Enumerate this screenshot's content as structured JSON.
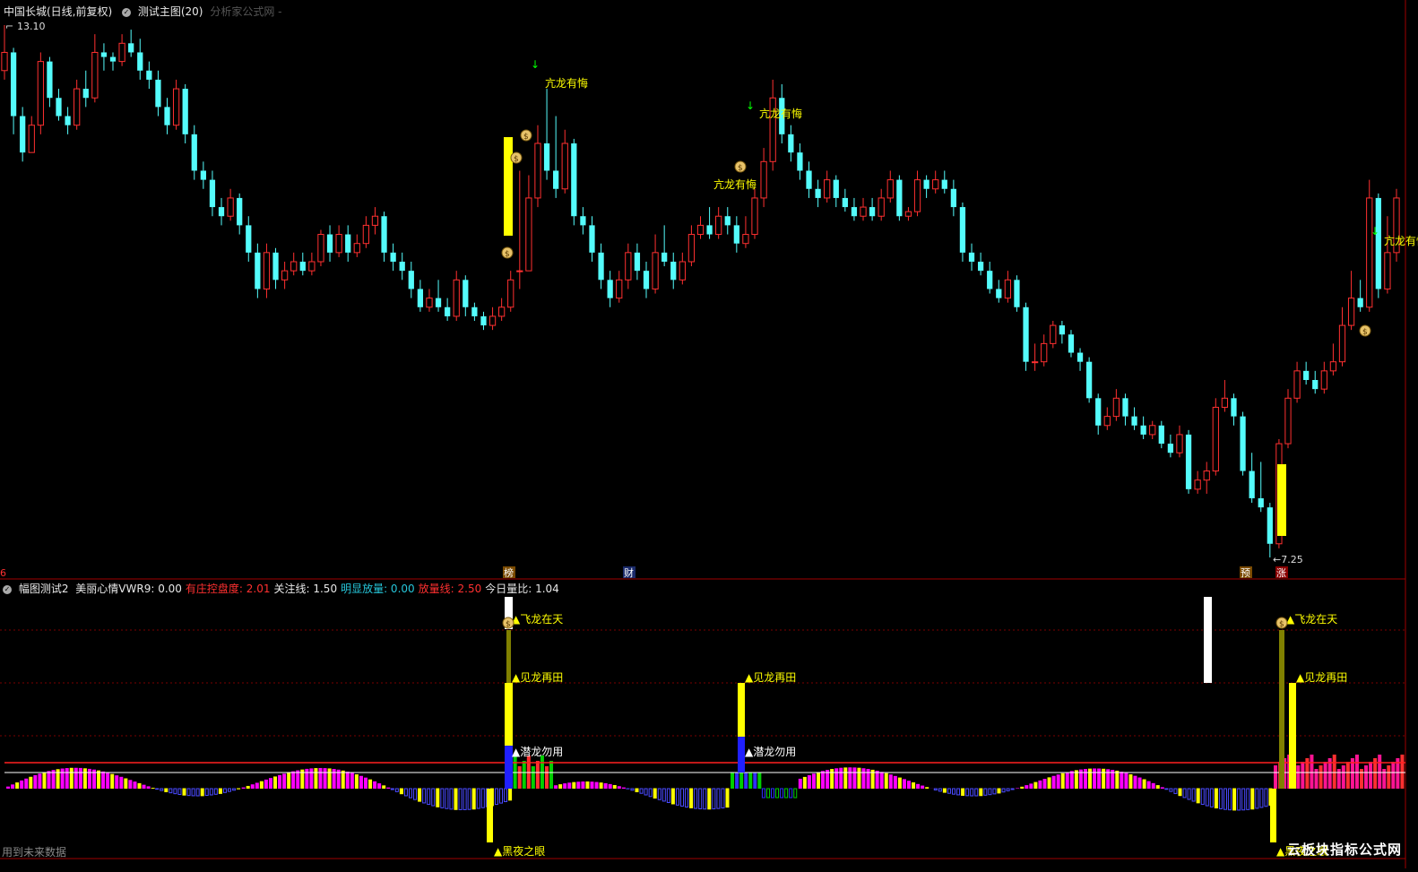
{
  "main_header": {
    "symbol": "中国长城(日线,前复权)",
    "indicator": "测试主图(20)",
    "source": "分析家公式网 -"
  },
  "price_labels": {
    "high": "13.10",
    "low": "7.25"
  },
  "badges": {
    "bang": "榜",
    "cai": "财",
    "yu": "预",
    "zhang": "涨",
    "left_edge": "6"
  },
  "main_signal_text": "亢龙有悔",
  "sub_header": {
    "name": "幅图测试2",
    "items": [
      {
        "label": "美丽心情VWR9:",
        "value": "0.00",
        "color": "#e8e8e8"
      },
      {
        "label": "有庄控盘度:",
        "value": "2.01",
        "color": "#ff3030"
      },
      {
        "label": "关注线:",
        "value": "1.50",
        "color": "#e8e8e8"
      },
      {
        "label": "明显放量:",
        "value": "0.00",
        "color": "#26c6da"
      },
      {
        "label": "放量线:",
        "value": "2.50",
        "color": "#ff3030"
      },
      {
        "label": "今日量比:",
        "value": "1.04",
        "color": "#e8e8e8"
      }
    ]
  },
  "sub_signals": {
    "fly": "飞龙在天",
    "see": "见龙再田",
    "hidden": "潜龙勿用",
    "night": "黑夜之眼"
  },
  "footer_note": "用到未来数据",
  "watermark": "云板块指标公式网",
  "colors": {
    "up": "#ff3030",
    "down": "#54fcfc",
    "yellow": "#ffff00",
    "magenta": "#ff00ff",
    "blue": "#3030ff",
    "green": "#00d000",
    "white": "#ffffff"
  },
  "chart_data": {
    "type": "candlestick",
    "price_high": 13.1,
    "price_low": 7.25,
    "candles": [
      [
        12.6,
        12.8,
        13.1,
        12.5
      ],
      [
        12.8,
        12.1,
        12.85,
        11.9
      ],
      [
        12.1,
        11.7,
        12.2,
        11.6
      ],
      [
        11.7,
        12.0,
        12.1,
        11.7
      ],
      [
        12.0,
        12.7,
        12.8,
        11.9
      ],
      [
        12.7,
        12.3,
        12.75,
        12.2
      ],
      [
        12.3,
        12.1,
        12.4,
        12.05
      ],
      [
        12.1,
        12.0,
        12.2,
        11.9
      ],
      [
        12.0,
        12.4,
        12.5,
        11.95
      ],
      [
        12.4,
        12.3,
        12.6,
        12.2
      ],
      [
        12.3,
        12.8,
        13.0,
        12.25
      ],
      [
        12.8,
        12.75,
        12.9,
        12.6
      ],
      [
        12.75,
        12.7,
        12.8,
        12.6
      ],
      [
        12.7,
        12.9,
        13.0,
        12.65
      ],
      [
        12.9,
        12.8,
        13.05,
        12.75
      ],
      [
        12.8,
        12.6,
        12.95,
        12.5
      ],
      [
        12.6,
        12.5,
        12.7,
        12.4
      ],
      [
        12.5,
        12.2,
        12.6,
        12.1
      ],
      [
        12.2,
        12.0,
        12.3,
        11.9
      ],
      [
        12.0,
        12.4,
        12.5,
        11.95
      ],
      [
        12.4,
        11.9,
        12.45,
        11.8
      ],
      [
        11.9,
        11.5,
        12.0,
        11.4
      ],
      [
        11.5,
        11.4,
        11.6,
        11.3
      ],
      [
        11.4,
        11.1,
        11.5,
        11.0
      ],
      [
        11.1,
        11.0,
        11.2,
        10.9
      ],
      [
        11.0,
        11.2,
        11.3,
        10.95
      ],
      [
        11.2,
        10.9,
        11.25,
        10.8
      ],
      [
        10.9,
        10.6,
        11.0,
        10.5
      ],
      [
        10.6,
        10.2,
        10.7,
        10.1
      ],
      [
        10.2,
        10.6,
        10.7,
        10.1
      ],
      [
        10.6,
        10.3,
        10.65,
        10.2
      ],
      [
        10.3,
        10.4,
        10.5,
        10.2
      ],
      [
        10.4,
        10.5,
        10.6,
        10.35
      ],
      [
        10.5,
        10.4,
        10.6,
        10.35
      ],
      [
        10.4,
        10.5,
        10.6,
        10.35
      ],
      [
        10.5,
        10.8,
        10.85,
        10.45
      ],
      [
        10.8,
        10.6,
        10.9,
        10.5
      ],
      [
        10.6,
        10.8,
        10.9,
        10.55
      ],
      [
        10.8,
        10.6,
        10.9,
        10.5
      ],
      [
        10.6,
        10.7,
        10.8,
        10.55
      ],
      [
        10.7,
        10.9,
        11.0,
        10.65
      ],
      [
        10.9,
        11.0,
        11.1,
        10.8
      ],
      [
        11.0,
        10.6,
        11.05,
        10.5
      ],
      [
        10.6,
        10.5,
        10.7,
        10.4
      ],
      [
        10.5,
        10.4,
        10.6,
        10.3
      ],
      [
        10.4,
        10.2,
        10.5,
        10.1
      ],
      [
        10.2,
        10.0,
        10.3,
        9.95
      ],
      [
        10.0,
        10.1,
        10.2,
        9.95
      ],
      [
        10.1,
        10.0,
        10.3,
        9.95
      ],
      [
        10.0,
        9.9,
        10.1,
        9.85
      ],
      [
        9.9,
        10.3,
        10.4,
        9.85
      ],
      [
        10.3,
        10.0,
        10.35,
        9.9
      ],
      [
        10.0,
        9.9,
        10.05,
        9.85
      ],
      [
        9.9,
        9.8,
        9.95,
        9.75
      ],
      [
        9.8,
        9.9,
        10.0,
        9.75
      ],
      [
        9.9,
        10.0,
        10.1,
        9.85
      ],
      [
        10.0,
        10.3,
        10.4,
        9.95
      ],
      [
        10.4,
        10.4,
        11.5,
        10.2
      ],
      [
        10.4,
        11.2,
        11.45,
        11.0
      ],
      [
        11.2,
        11.8,
        12.0,
        11.1
      ],
      [
        11.8,
        11.5,
        12.4,
        11.4
      ],
      [
        11.5,
        11.3,
        12.1,
        11.2
      ],
      [
        11.3,
        11.8,
        11.95,
        11.25
      ],
      [
        11.8,
        11.0,
        11.85,
        10.9
      ],
      [
        11.0,
        10.9,
        11.1,
        10.8
      ],
      [
        10.9,
        10.6,
        11.0,
        10.5
      ],
      [
        10.6,
        10.3,
        10.7,
        10.2
      ],
      [
        10.3,
        10.1,
        10.4,
        10.0
      ],
      [
        10.1,
        10.3,
        10.4,
        10.05
      ],
      [
        10.3,
        10.6,
        10.7,
        10.2
      ],
      [
        10.6,
        10.4,
        10.7,
        10.3
      ],
      [
        10.4,
        10.2,
        10.5,
        10.1
      ],
      [
        10.2,
        10.6,
        10.8,
        10.15
      ],
      [
        10.6,
        10.5,
        10.9,
        10.45
      ],
      [
        10.5,
        10.3,
        10.6,
        10.2
      ],
      [
        10.3,
        10.5,
        10.6,
        10.25
      ],
      [
        10.5,
        10.8,
        10.9,
        10.45
      ],
      [
        10.8,
        10.9,
        11.0,
        10.75
      ],
      [
        10.9,
        10.8,
        11.1,
        10.75
      ],
      [
        10.8,
        11.0,
        11.1,
        10.75
      ],
      [
        11.0,
        10.9,
        11.1,
        10.8
      ],
      [
        10.9,
        10.7,
        11.0,
        10.6
      ],
      [
        10.7,
        10.8,
        11.0,
        10.65
      ],
      [
        10.8,
        11.2,
        11.3,
        10.75
      ],
      [
        11.2,
        11.6,
        11.75,
        11.1
      ],
      [
        11.6,
        12.3,
        12.5,
        11.5
      ],
      [
        12.3,
        11.9,
        12.45,
        11.8
      ],
      [
        11.9,
        11.7,
        12.0,
        11.6
      ],
      [
        11.7,
        11.5,
        11.8,
        11.4
      ],
      [
        11.5,
        11.3,
        11.6,
        11.2
      ],
      [
        11.3,
        11.2,
        11.4,
        11.1
      ],
      [
        11.2,
        11.4,
        11.5,
        11.15
      ],
      [
        11.4,
        11.2,
        11.45,
        11.1
      ],
      [
        11.2,
        11.1,
        11.3,
        11.05
      ],
      [
        11.1,
        11.0,
        11.2,
        10.95
      ],
      [
        11.0,
        11.1,
        11.2,
        10.95
      ],
      [
        11.1,
        11.0,
        11.2,
        10.95
      ],
      [
        11.0,
        11.2,
        11.3,
        10.95
      ],
      [
        11.2,
        11.4,
        11.5,
        11.15
      ],
      [
        11.4,
        11.0,
        11.45,
        10.95
      ],
      [
        11.0,
        11.05,
        11.1,
        10.95
      ],
      [
        11.05,
        11.4,
        11.5,
        11.0
      ],
      [
        11.4,
        11.3,
        11.45,
        11.2
      ],
      [
        11.3,
        11.4,
        11.5,
        11.25
      ],
      [
        11.4,
        11.3,
        11.5,
        11.25
      ],
      [
        11.3,
        11.1,
        11.4,
        11.0
      ],
      [
        11.1,
        10.6,
        11.15,
        10.5
      ],
      [
        10.6,
        10.5,
        10.7,
        10.4
      ],
      [
        10.5,
        10.4,
        10.6,
        10.35
      ],
      [
        10.4,
        10.2,
        10.5,
        10.15
      ],
      [
        10.2,
        10.1,
        10.3,
        10.05
      ],
      [
        10.1,
        10.3,
        10.4,
        10.05
      ],
      [
        10.3,
        10.0,
        10.35,
        9.95
      ],
      [
        10.0,
        9.4,
        10.05,
        9.3
      ],
      [
        9.4,
        9.4,
        9.6,
        9.3
      ],
      [
        9.4,
        9.6,
        9.7,
        9.35
      ],
      [
        9.6,
        9.8,
        9.85,
        9.55
      ],
      [
        9.8,
        9.7,
        9.85,
        9.6
      ],
      [
        9.7,
        9.5,
        9.75,
        9.45
      ],
      [
        9.5,
        9.4,
        9.55,
        9.3
      ],
      [
        9.4,
        9.0,
        9.45,
        8.95
      ],
      [
        9.0,
        8.7,
        9.05,
        8.6
      ],
      [
        8.7,
        8.8,
        8.9,
        8.65
      ],
      [
        8.8,
        9.0,
        9.1,
        8.75
      ],
      [
        9.0,
        8.8,
        9.05,
        8.7
      ],
      [
        8.8,
        8.7,
        8.9,
        8.65
      ],
      [
        8.7,
        8.6,
        8.8,
        8.55
      ],
      [
        8.6,
        8.7,
        8.75,
        8.55
      ],
      [
        8.7,
        8.5,
        8.75,
        8.45
      ],
      [
        8.5,
        8.4,
        8.6,
        8.35
      ],
      [
        8.4,
        8.6,
        8.7,
        8.35
      ],
      [
        8.6,
        8.0,
        8.65,
        7.95
      ],
      [
        8.0,
        8.1,
        8.2,
        7.95
      ],
      [
        8.1,
        8.2,
        8.3,
        7.95
      ],
      [
        8.2,
        8.9,
        9.0,
        8.15
      ],
      [
        8.9,
        9.0,
        9.2,
        8.85
      ],
      [
        9.0,
        8.8,
        9.05,
        8.7
      ],
      [
        8.8,
        8.2,
        8.85,
        8.15
      ],
      [
        8.2,
        7.9,
        8.4,
        7.85
      ],
      [
        7.9,
        7.8,
        8.3,
        7.75
      ],
      [
        7.8,
        7.4,
        7.85,
        7.25
      ],
      [
        7.4,
        8.5,
        8.55,
        7.35
      ],
      [
        8.5,
        9.0,
        9.1,
        8.45
      ],
      [
        9.0,
        9.3,
        9.4,
        8.95
      ],
      [
        9.3,
        9.2,
        9.4,
        9.15
      ],
      [
        9.2,
        9.1,
        9.3,
        9.05
      ],
      [
        9.1,
        9.3,
        9.4,
        9.05
      ],
      [
        9.3,
        9.4,
        9.6,
        9.25
      ],
      [
        9.4,
        9.8,
        10.0,
        9.35
      ],
      [
        9.8,
        10.1,
        10.4,
        9.75
      ],
      [
        10.1,
        10.0,
        10.3,
        9.95
      ],
      [
        10.0,
        11.2,
        11.4,
        9.95
      ],
      [
        11.2,
        10.2,
        11.25,
        10.1
      ],
      [
        10.2,
        10.6,
        11.0,
        10.15
      ],
      [
        10.6,
        11.2,
        11.3,
        10.5
      ]
    ]
  }
}
